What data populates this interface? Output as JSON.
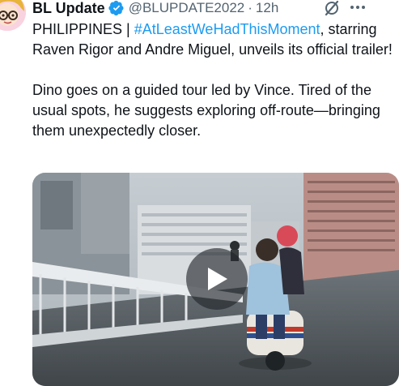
{
  "tweet": {
    "author": {
      "display_name": "BL Update",
      "handle": "@BLUPDATE2022",
      "verified": true,
      "avatar_icon": "cartoon-avatar-icon"
    },
    "separator": "·",
    "time": "12h",
    "text": {
      "line1_prefix": "PHILIPPINES | ",
      "hashtag": "#AtLeastWeHadThisMoment",
      "line1_suffix": ", starring Raven Rigor and Andre Miguel, unveils its official trailer!",
      "paragraph2": "Dino goes on a guided tour led by Vince. Tired of the usual spots, he suggests exploring off-route—bringing them unexpectedly closer."
    },
    "media": {
      "type": "video",
      "play_icon": "play-icon"
    }
  },
  "colors": {
    "link": "#1d9bf0",
    "secondary_text": "#536471",
    "verified": "#1d9bf0"
  }
}
